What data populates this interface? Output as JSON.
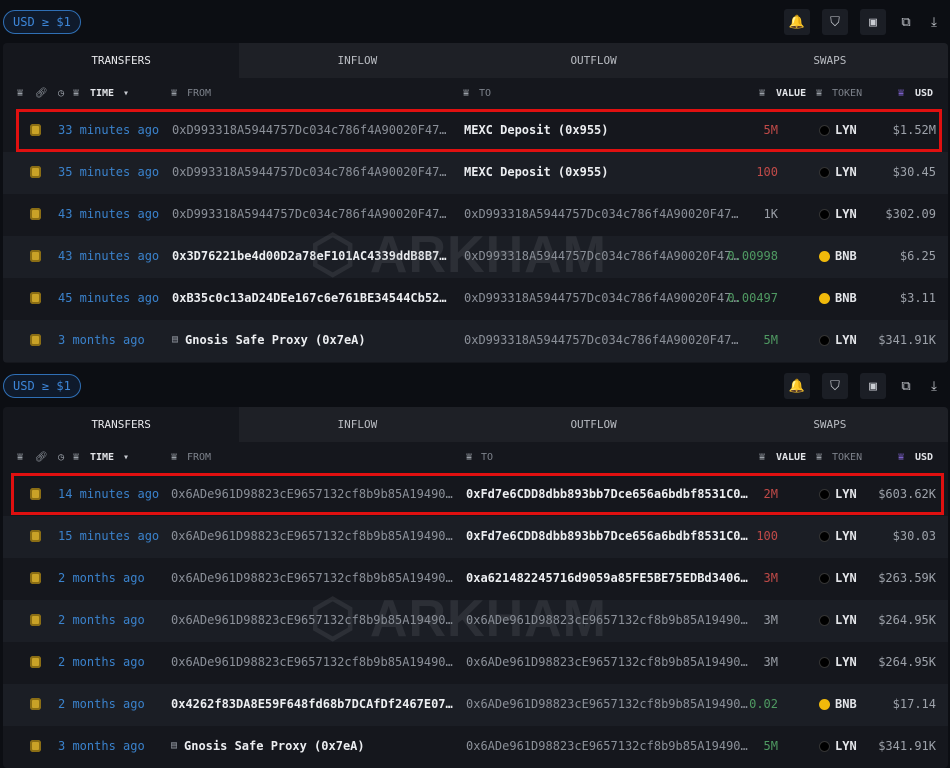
{
  "sections": [
    {
      "filter_label": "USD ≥ $1",
      "tabs": [
        "TRANSFERS",
        "INFLOW",
        "OUTFLOW",
        "SWAPS"
      ],
      "headers": {
        "time": "TIME",
        "from": "FROM",
        "to": "TO",
        "value": "VALUE",
        "token": "TOKEN",
        "usd": "USD"
      },
      "rows": [
        {
          "time": "33 minutes ago",
          "from": "0xD993318A5944757Dc034c786f4A90020F47…",
          "from_style": "gray",
          "to": "MEXC Deposit (0x955)",
          "to_style": "white",
          "value": "5M",
          "value_color": "red",
          "token": "LYN",
          "usd": "$1.52M"
        },
        {
          "time": "35 minutes ago",
          "from": "0xD993318A5944757Dc034c786f4A90020F47…",
          "from_style": "gray",
          "to": "MEXC Deposit (0x955)",
          "to_style": "white",
          "value": "100",
          "value_color": "red",
          "token": "LYN",
          "usd": "$30.45"
        },
        {
          "time": "43 minutes ago",
          "from": "0xD993318A5944757Dc034c786f4A90020F47…",
          "from_style": "gray",
          "to": "0xD993318A5944757Dc034c786f4A90020F47…",
          "to_style": "gray",
          "value": "1K",
          "value_color": "vgray",
          "token": "LYN",
          "usd": "$302.09"
        },
        {
          "time": "43 minutes ago",
          "from": "0x3D76221be4d00D2a78eF101AC4339ddB8B7…",
          "from_style": "white",
          "to": "0xD993318A5944757Dc034c786f4A90020F47…",
          "to_style": "gray",
          "value": "0.00998",
          "value_color": "green",
          "token": "BNB",
          "usd": "$6.25"
        },
        {
          "time": "45 minutes ago",
          "from": "0xB35c0c13aD24DEe167c6e761BE34544Cb52…",
          "from_style": "white",
          "to": "0xD993318A5944757Dc034c786f4A90020F47…",
          "to_style": "gray",
          "value": "0.00497",
          "value_color": "green",
          "token": "BNB",
          "usd": "$3.11"
        },
        {
          "time": "3 months ago",
          "from": "Gnosis Safe Proxy (0x7eA)",
          "from_style": "white",
          "from_doc": true,
          "to": "0xD993318A5944757Dc034c786f4A90020F47…",
          "to_style": "gray",
          "value": "5M",
          "value_color": "green",
          "token": "LYN",
          "usd": "$341.91K"
        }
      ]
    },
    {
      "filter_label": "USD ≥ $1",
      "tabs": [
        "TRANSFERS",
        "INFLOW",
        "OUTFLOW",
        "SWAPS"
      ],
      "headers": {
        "time": "TIME",
        "from": "FROM",
        "to": "TO",
        "value": "VALUE",
        "token": "TOKEN",
        "usd": "USD"
      },
      "rows": [
        {
          "time": "14 minutes ago",
          "from": "0x6ADe961D98823cE9657132cf8b9b85A19490…",
          "from_style": "gray",
          "to": "0xFd7e6CDD8dbb893bb7Dce656a6bdbf8531C0…",
          "to_style": "white",
          "value": "2M",
          "value_color": "red",
          "token": "LYN",
          "usd": "$603.62K"
        },
        {
          "time": "15 minutes ago",
          "from": "0x6ADe961D98823cE9657132cf8b9b85A19490…",
          "from_style": "gray",
          "to": "0xFd7e6CDD8dbb893bb7Dce656a6bdbf8531C0…",
          "to_style": "white",
          "value": "100",
          "value_color": "red",
          "token": "LYN",
          "usd": "$30.03"
        },
        {
          "time": "2 months ago",
          "from": "0x6ADe961D98823cE9657132cf8b9b85A19490…",
          "from_style": "gray",
          "to": "0xa621482245716d9059a85FE5BE75EDBd3406…",
          "to_style": "white",
          "value": "3M",
          "value_color": "red",
          "token": "LYN",
          "usd": "$263.59K"
        },
        {
          "time": "2 months ago",
          "from": "0x6ADe961D98823cE9657132cf8b9b85A19490…",
          "from_style": "gray",
          "to": "0x6ADe961D98823cE9657132cf8b9b85A19490…",
          "to_style": "gray",
          "value": "3M",
          "value_color": "vgray",
          "token": "LYN",
          "usd": "$264.95K"
        },
        {
          "time": "2 months ago",
          "from": "0x6ADe961D98823cE9657132cf8b9b85A19490…",
          "from_style": "gray",
          "to": "0x6ADe961D98823cE9657132cf8b9b85A19490…",
          "to_style": "gray",
          "value": "3M",
          "value_color": "vgray",
          "token": "LYN",
          "usd": "$264.95K"
        },
        {
          "time": "2 months ago",
          "from": "0x4262f83DA8E59F648fd68b7DCAfDf2467E07…",
          "from_style": "white",
          "to": "0x6ADe961D98823cE9657132cf8b9b85A19490…",
          "to_style": "gray",
          "value": "0.02",
          "value_color": "green",
          "token": "BNB",
          "usd": "$17.14"
        },
        {
          "time": "3 months ago",
          "from": "Gnosis Safe Proxy (0x7eA)",
          "from_style": "white",
          "from_doc": true,
          "to": "0x6ADe961D98823cE9657132cf8b9b85A19490…",
          "to_style": "gray",
          "value": "5M",
          "value_color": "green",
          "token": "LYN",
          "usd": "$341.91K"
        }
      ]
    }
  ],
  "watermark": "ARKHAM"
}
